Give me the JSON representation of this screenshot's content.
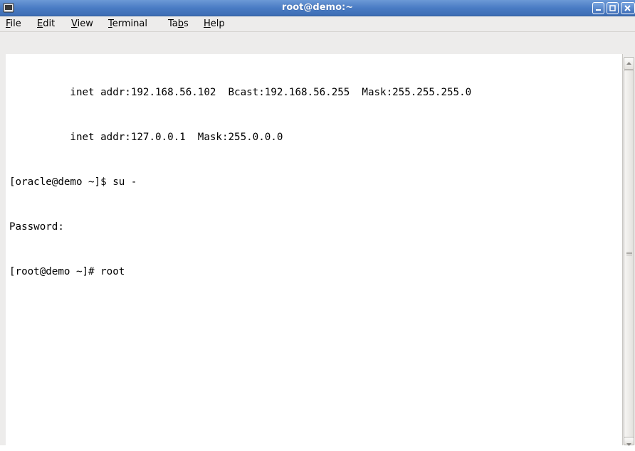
{
  "window": {
    "title": "root@demo:~",
    "icon": "terminal-icon"
  },
  "menu": {
    "file_pre": "",
    "file_mn": "F",
    "file_post": "ile",
    "edit_pre": "",
    "edit_mn": "E",
    "edit_post": "dit",
    "view_pre": "",
    "view_mn": "V",
    "view_post": "iew",
    "terminal_pre": "",
    "terminal_mn": "T",
    "terminal_post": "erminal",
    "tabs_pre": "Ta",
    "tabs_mn": "b",
    "tabs_post": "s",
    "help_pre": "",
    "help_mn": "H",
    "help_post": "elp"
  },
  "terminal": {
    "lines": [
      "          inet addr:192.168.56.102  Bcast:192.168.56.255  Mask:255.255.255.0",
      "          inet addr:127.0.0.1  Mask:255.0.0.0",
      "[oracle@demo ~]$ su -",
      "Password:",
      "[root@demo ~]# root"
    ]
  },
  "colors": {
    "titlebar": "#4a7cc4",
    "menubar": "#edeceb",
    "terminal_bg": "#ffffff",
    "terminal_fg": "#000000"
  }
}
